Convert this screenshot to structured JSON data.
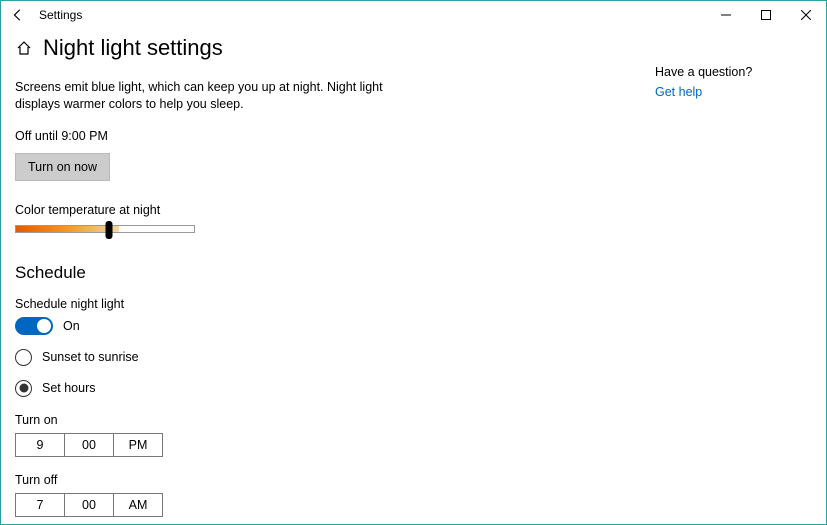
{
  "window": {
    "title": "Settings"
  },
  "page": {
    "title": "Night light settings",
    "description": "Screens emit blue light, which can keep you up at night. Night light displays warmer colors to help you sleep.",
    "status": "Off until 9:00 PM",
    "turn_on_label": "Turn on now",
    "color_temp_label": "Color temperature at night"
  },
  "schedule": {
    "heading": "Schedule",
    "toggle_label": "Schedule night light",
    "toggle_state": "On",
    "option_sunset": "Sunset to sunrise",
    "option_set_hours": "Set hours",
    "selected": "set_hours",
    "turn_on_label": "Turn on",
    "turn_on": {
      "hour": "9",
      "minute": "00",
      "ampm": "PM"
    },
    "turn_off_label": "Turn off",
    "turn_off": {
      "hour": "7",
      "minute": "00",
      "ampm": "AM"
    }
  },
  "side": {
    "question": "Have a question?",
    "help": "Get help"
  }
}
